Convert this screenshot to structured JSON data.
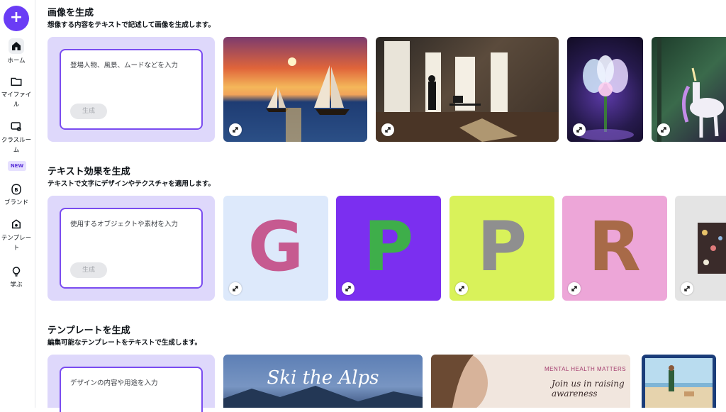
{
  "sidebar": {
    "create_label": "+",
    "items": [
      {
        "label": "ホーム"
      },
      {
        "label": "マイファイル"
      },
      {
        "label": "クラスルーム"
      },
      {
        "label": "ブランド"
      },
      {
        "label": "テンプレート"
      },
      {
        "label": "学ぶ"
      }
    ],
    "new_badge": "NEW"
  },
  "sections": [
    {
      "title": "画像を生成",
      "subtitle": "想像する内容をテキストで記述して画像を生成します。",
      "prompt_placeholder": "登場人物、風景、ムードなどを入力",
      "generate_label": "生成"
    },
    {
      "title": "テキスト効果を生成",
      "subtitle": "テキストで文字にデザインやテクスチャを適用します。",
      "prompt_placeholder": "使用するオブジェクトや素材を入力",
      "generate_label": "生成",
      "letters": [
        "G",
        "P",
        "P",
        "R"
      ]
    },
    {
      "title": "テンプレートを生成",
      "subtitle": "編集可能なテンプレートをテキストで生成します。",
      "prompt_placeholder": "デザインの内容や用途を入力",
      "templates": [
        {
          "text": "Ski the Alps"
        },
        {
          "heading": "MENTAL HEALTH MATTERS",
          "text": "Join us in raising awareness"
        }
      ]
    }
  ],
  "colors": {
    "accent": "#6a3cf5",
    "panel": "#ded8fb"
  }
}
